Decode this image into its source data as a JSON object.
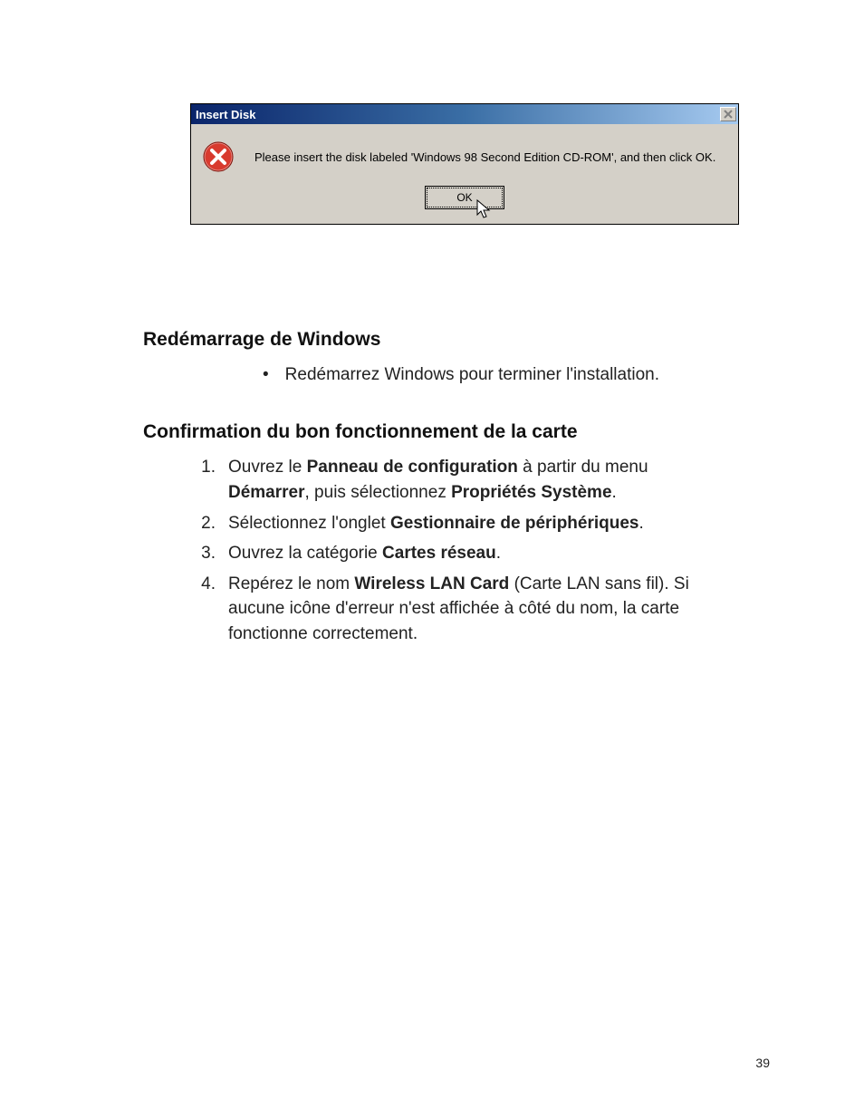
{
  "dialog": {
    "title": "Insert Disk",
    "message": "Please insert the disk labeled 'Windows 98 Second Edition CD-ROM', and then click OK.",
    "ok_label": "OK"
  },
  "section1": {
    "heading": "Redémarrage de Windows",
    "bullet": "Redémarrez Windows pour terminer l'installation."
  },
  "section2": {
    "heading": "Confirmation du bon fonctionnement de la carte",
    "steps": [
      {
        "pre": "Ouvrez le ",
        "b1": "Panneau de configuration",
        "mid": " à partir du menu ",
        "b2": "Démarrer",
        "post": ", puis sélectionnez ",
        "b3": "Propriétés Système",
        "tail": "."
      },
      {
        "pre": "Sélectionnez l'onglet ",
        "b1": "Gestionnaire de périphériques",
        "tail": "."
      },
      {
        "pre": "Ouvrez la catégorie ",
        "b1": "Cartes réseau",
        "tail": "."
      },
      {
        "pre": "Repérez le nom ",
        "b1": "Wireless LAN Card",
        "post": " (Carte LAN sans fil). Si aucune icône d'erreur n'est affichée à côté du nom, la carte fonctionne correctement."
      }
    ]
  },
  "page_number": "39"
}
